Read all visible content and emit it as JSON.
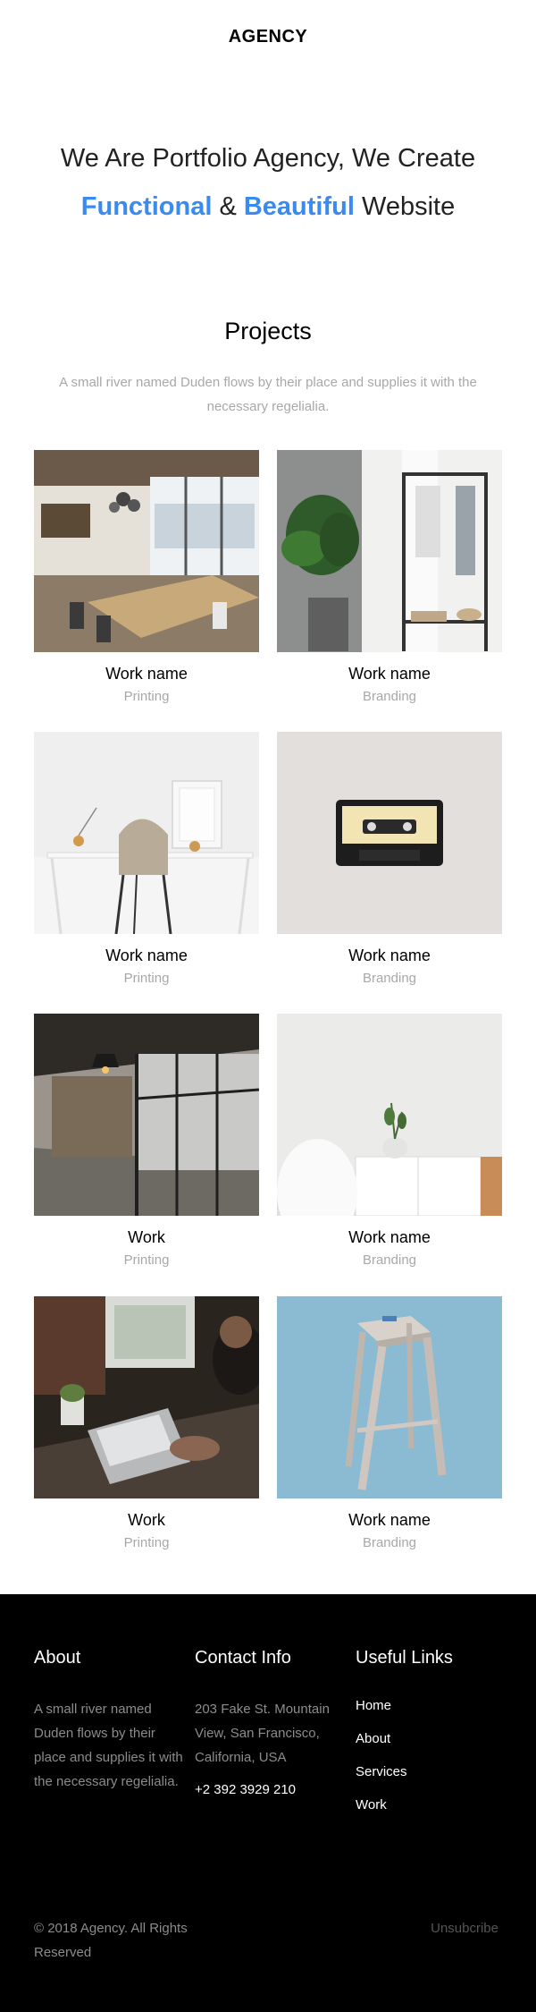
{
  "brand": {
    "logo": "AGENCY"
  },
  "hero": {
    "line1": "We Are Portfolio Agency, We Create",
    "word_functional": "Functional",
    "ampersand": "&",
    "word_beautiful": "Beautiful",
    "word_website": "Website"
  },
  "projects": {
    "title": "Projects",
    "description": "A small river named Duden flows by their place and supplies it with the necessary regelialia.",
    "items": [
      {
        "title": "Work name",
        "category": "Printing"
      },
      {
        "title": "Work name",
        "category": "Branding"
      },
      {
        "title": "Work name",
        "category": "Printing"
      },
      {
        "title": "Work name",
        "category": "Branding"
      },
      {
        "title": "Work",
        "category": "Printing"
      },
      {
        "title": "Work name",
        "category": "Branding"
      },
      {
        "title": "Work",
        "category": "Printing"
      },
      {
        "title": "Work name",
        "category": "Branding"
      }
    ]
  },
  "footer": {
    "about": {
      "heading": "About",
      "text": "A small river named Duden flows by their place and supplies it with the necessary regelialia."
    },
    "contact": {
      "heading": "Contact Info",
      "address": "203 Fake St. Mountain View, San Francisco, California, USA",
      "phone": "+2 392 3929 210"
    },
    "links": {
      "heading": "Useful Links",
      "items": [
        "Home",
        "About",
        "Services",
        "Work"
      ]
    },
    "copyright": "© 2018 Agency. All Rights Reserved",
    "unsubscribe": "Unsubcribe"
  },
  "colors": {
    "accent": "#3a8bf0",
    "footer_bg": "#000000",
    "muted_text": "#a8a8a8"
  }
}
